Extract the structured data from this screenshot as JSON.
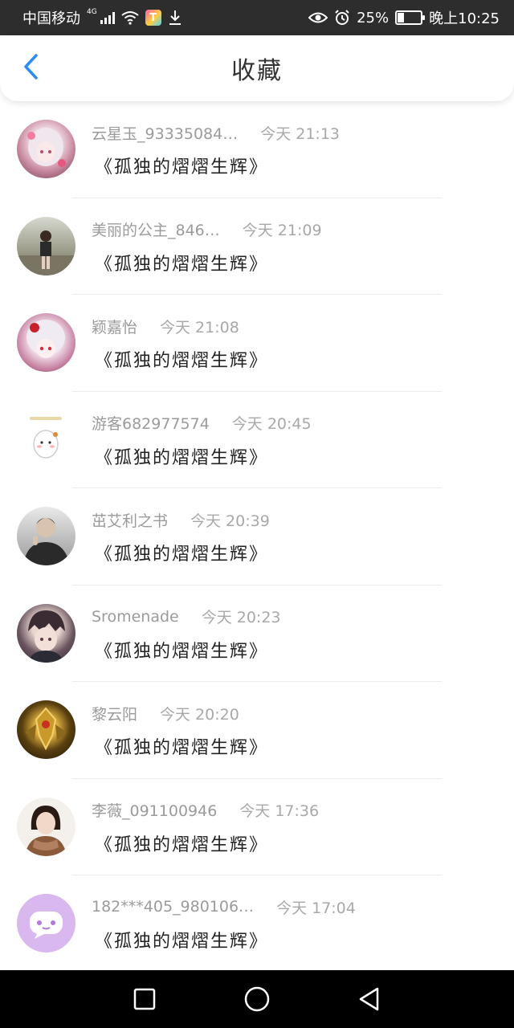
{
  "status_bar": {
    "carrier": "中国移动",
    "network": "4G",
    "battery": "25%",
    "time": "晚上10:25",
    "icons": [
      "signal-icon",
      "wifi-icon",
      "app-notification-icon",
      "download-icon",
      "eye-icon",
      "alarm-icon",
      "battery-icon"
    ]
  },
  "header": {
    "title": "收藏",
    "back_icon": "chevron-left-icon",
    "accent_color": "#2f8bf0"
  },
  "items": [
    {
      "username": "云星玉_93335084…",
      "time": "今天 21:13",
      "title": "《孤独的熠熠生辉》",
      "avatar": "anime-girl-avatar"
    },
    {
      "username": "美丽的公主_846…",
      "time": "今天 21:09",
      "title": "《孤独的熠熠生辉》",
      "avatar": "photo-avatar"
    },
    {
      "username": "颖嘉怡",
      "time": "今天 21:08",
      "title": "《孤独的熠熠生辉》",
      "avatar": "anime-girl-avatar"
    },
    {
      "username": "游客682977574",
      "time": "今天 20:45",
      "title": "《孤独的熠熠生辉》",
      "avatar": "cartoon-avatar"
    },
    {
      "username": "茁艾利之书",
      "time": "今天 20:39",
      "title": "《孤独的熠熠生辉》",
      "avatar": "photo-avatar"
    },
    {
      "username": "Sromenade",
      "time": "今天 20:23",
      "title": "《孤独的熠熠生辉》",
      "avatar": "anime-boy-avatar"
    },
    {
      "username": "黎云阳",
      "time": "今天 20:20",
      "title": "《孤独的熠熠生辉》",
      "avatar": "armor-avatar"
    },
    {
      "username": "李薇_091100946",
      "time": "今天 17:36",
      "title": "《孤独的熠熠生辉》",
      "avatar": "photo-avatar"
    },
    {
      "username": "182***405_980106…",
      "time": "今天 17:04",
      "title": "《孤独的熠熠生辉》",
      "avatar": "default-chat-avatar"
    }
  ],
  "nav_bar": {
    "icons": [
      "recents-square-icon",
      "home-circle-icon",
      "back-triangle-icon"
    ]
  }
}
